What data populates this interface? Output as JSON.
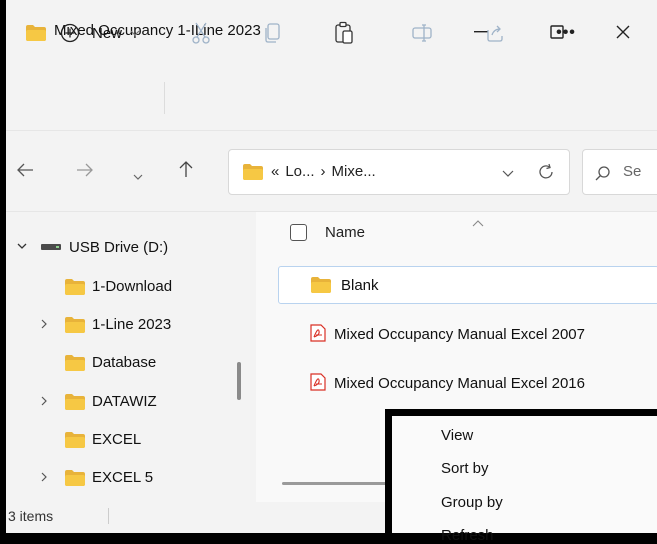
{
  "window": {
    "title": "Mixed Occupancy 1-ILine 2023",
    "minimize_icon": "minimize-icon",
    "maximize_icon": "maximize-icon",
    "close_icon": "close-icon"
  },
  "toolbar": {
    "new_label": "New",
    "more_label": "•••",
    "icons": [
      "new-plus-icon",
      "cut-icon",
      "copy-icon",
      "paste-icon",
      "rename-icon",
      "share-icon",
      "more-icon"
    ]
  },
  "navigation": {
    "address_segments": [
      "«",
      "Lo...",
      "›",
      "Mixe..."
    ],
    "search_placeholder": "Se",
    "icons": [
      "back-arrow-icon",
      "forward-arrow-icon",
      "recent-chevron-icon",
      "up-arrow-icon",
      "refresh-icon",
      "search-icon"
    ]
  },
  "sidebar": {
    "items": [
      {
        "label": "USB Drive (D:)",
        "expanded": true,
        "kind": "drive"
      },
      {
        "label": "1-Download",
        "expandable": false,
        "kind": "folder"
      },
      {
        "label": "1-Line 2023",
        "expandable": true,
        "kind": "folder"
      },
      {
        "label": "Database",
        "expandable": false,
        "kind": "folder"
      },
      {
        "label": "DATAWIZ",
        "expandable": true,
        "kind": "folder"
      },
      {
        "label": "EXCEL",
        "expandable": false,
        "kind": "folder"
      },
      {
        "label": "EXCEL 5",
        "expandable": true,
        "kind": "folder"
      }
    ]
  },
  "file_list": {
    "column_name": "Name",
    "items": [
      {
        "name": "Blank",
        "type": "folder",
        "selected": true
      },
      {
        "name": "Mixed Occupancy Manual Excel 2007",
        "type": "pdf"
      },
      {
        "name": "Mixed Occupancy Manual Excel 2016",
        "type": "pdf"
      }
    ]
  },
  "status_bar": {
    "item_count": "3 items"
  },
  "context_menu": {
    "items": [
      "View",
      "Sort by",
      "Group by",
      "Refresh"
    ]
  },
  "colors": {
    "folder": "#f4c542",
    "accent": "#0067c0",
    "pdf": "#d93025"
  }
}
